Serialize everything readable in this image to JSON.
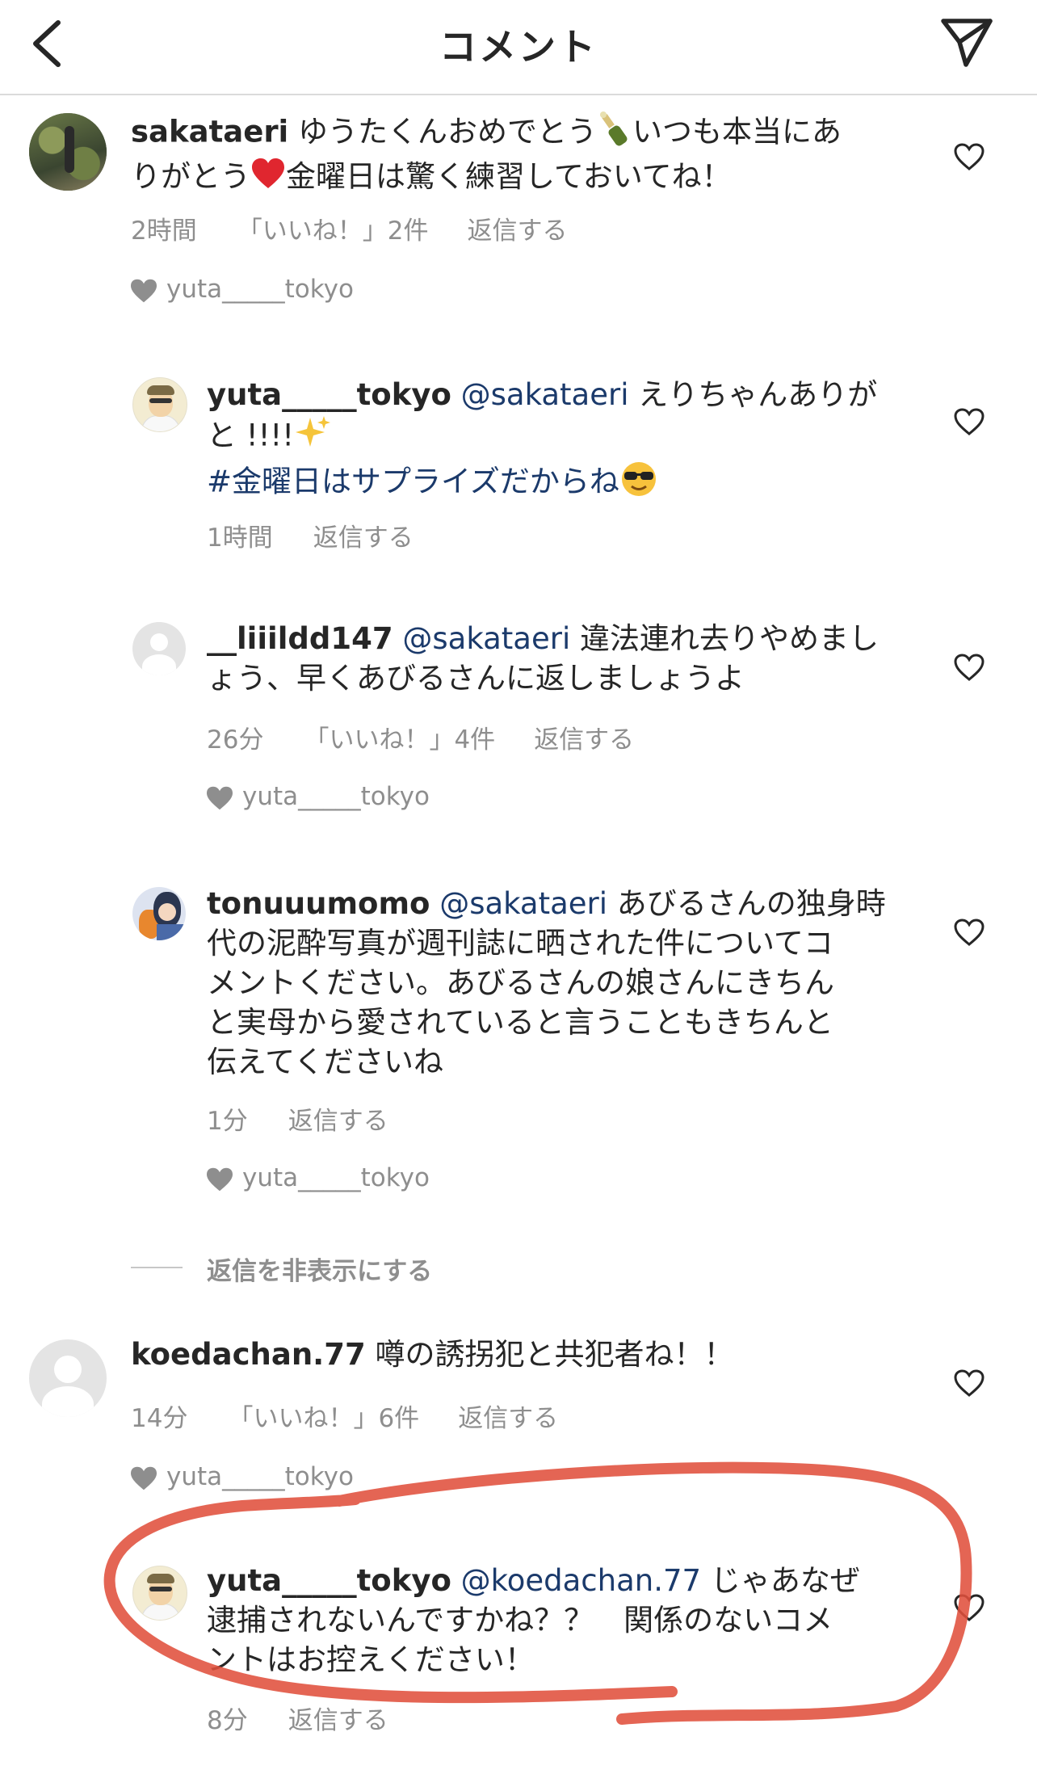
{
  "header": {
    "title": "コメント",
    "back_icon": "chevron-left-icon",
    "send_icon": "paper-plane-icon"
  },
  "colors": {
    "text": "#262626",
    "secondary": "#8e8e8e",
    "link": "#1b3a6b",
    "highlight_ring": "#e0503c"
  },
  "comments": [
    {
      "username": "sakataeri",
      "line1": "ゆうたくんおめでとう",
      "line1_tail": "いつも本当にあ",
      "line2_a": "りがとう",
      "line2_b": "金曜日は驚く練習しておいてね！",
      "time": "2時間",
      "likes": "「いいね！」2件",
      "reply": "返信する",
      "liked_by": "yuta_____tokyo"
    },
    {
      "username": "yuta_____tokyo",
      "mention": "@sakataeri",
      "line1_tail": "えりちゃんありが",
      "line2": "と !!!!",
      "hashtag": "#金曜日はサプライズだからね",
      "time": "1時間",
      "reply": "返信する"
    },
    {
      "username": "__liiildd147",
      "mention": "@sakataeri",
      "line1_tail": "違法連れ去りやめまし",
      "line2": "ょう、早くあびるさんに返しましょうよ",
      "time": "26分",
      "likes": "「いいね！」4件",
      "reply": "返信する",
      "liked_by": "yuta_____tokyo"
    },
    {
      "username": "tonuuumomo",
      "mention": "@sakataeri",
      "line1_tail": "あびるさんの独身時",
      "line2": "代の泥酔写真が週刊誌に晒された件についてコ",
      "line3": "メントください。あびるさんの娘さんにきちん",
      "line4": "と実母から愛されていると言うこともきちんと",
      "line5": "伝えてくださいね",
      "time": "1分",
      "reply": "返信する",
      "liked_by": "yuta_____tokyo"
    },
    {
      "hide_replies": "返信を非表示にする"
    },
    {
      "username": "koedachan.77",
      "line1_tail": "噂の誘拐犯と共犯者ね！！",
      "time": "14分",
      "likes": "「いいね！」6件",
      "reply": "返信する",
      "liked_by": "yuta_____tokyo"
    },
    {
      "username": "yuta_____tokyo",
      "mention": "@koedachan.77",
      "line1_tail": "じゃあなぜ",
      "line2": "逮捕されないんですかね？？　関係のないコメ",
      "line3": "ントはお控えください！",
      "time": "8分",
      "reply": "返信する"
    }
  ]
}
